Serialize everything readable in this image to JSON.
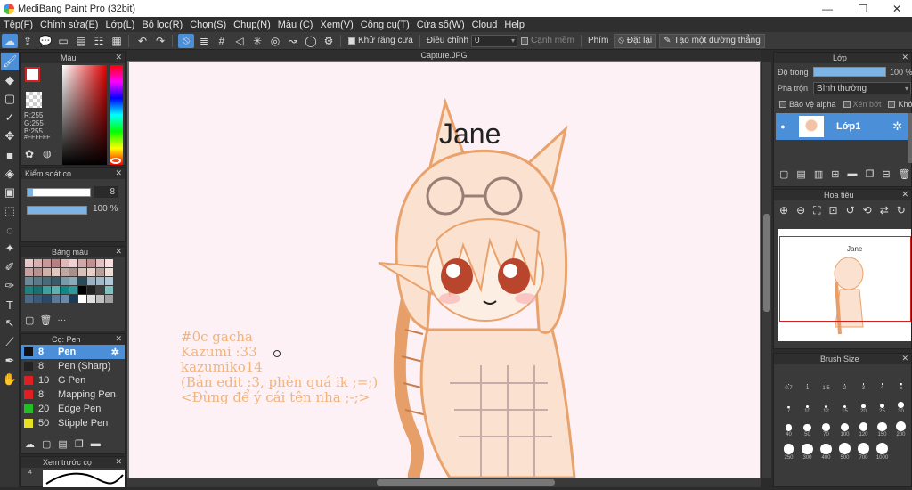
{
  "window": {
    "title": "MediBang Paint Pro (32bit)",
    "controls": [
      "—",
      "❐",
      "✕"
    ]
  },
  "menu": [
    "Tệp(F)",
    "Chỉnh sửa(E)",
    "Lớp(L)",
    "Bộ lọc(R)",
    "Chọn(S)",
    "Chụp(N)",
    "Màu (C)",
    "Xem(V)",
    "Công cụ(T)",
    "Cửa số(W)",
    "Cloud",
    "Help"
  ],
  "toolbar": {
    "antialias_label": "Khử răng cưa",
    "adjust_label": "Điều chỉnh",
    "adjust_value": "0",
    "smooth_edge_label": "Cạnh mềm",
    "shortcut_label": "Phím",
    "reset_label": "Đặt lại",
    "straight_line_label": "Tạo một đường thẳng"
  },
  "color_panel": {
    "title": "Màu",
    "r": "R:255",
    "g": "G:255",
    "b": "B:255",
    "hex": "#FFFFFF",
    "foreground": "#d42020",
    "background": "#ffffff"
  },
  "brush_control": {
    "title": "Kiểm soát cọ",
    "size_value": "8",
    "opacity_value": "100 %"
  },
  "swatch_panel": {
    "title": "Bảng màu",
    "colors": [
      "#e8c8c8",
      "#d8b0b0",
      "#c89898",
      "#b88080",
      "#e0b8b8",
      "#f0d0d0",
      "#d0a8a8",
      "#c09090",
      "#e0c0c0",
      "#f8e0e0",
      "#c8a0a0",
      "#b89090",
      "#d0b0a8",
      "#e0c8c0",
      "#c0a8a0",
      "#a89088",
      "#d8c0b8",
      "#e8d0c8",
      "#b8a098",
      "#f0e0d8",
      "#6a8a9a",
      "#5a7a8a",
      "#4a6a7a",
      "#3a5a6a",
      "#7a9aaa",
      "#8aaaba",
      "#2a4a5a",
      "#9ab0c0",
      "#a0b8c8",
      "#b0c8d8",
      "#208080",
      "#1a7070",
      "#40a0a0",
      "#60b0b0",
      "#108888",
      "#309898",
      "#000000",
      "#202020",
      "#404040",
      "#80c0c0",
      "#4a6a8a",
      "#3a5a7a",
      "#2a4a6a",
      "#5a7a9a",
      "#6a8aaa",
      "#1a3a5a",
      "#ffffff",
      "#e0e0e0",
      "#c0c0c0",
      "#a0a0a0"
    ],
    "more": "···"
  },
  "brush_panel": {
    "title": "Cọ: Pen",
    "items": [
      {
        "size": "8",
        "name": "Pen",
        "color": "#111111",
        "selected": true
      },
      {
        "size": "8",
        "name": "Pen (Sharp)",
        "color": "#222222",
        "selected": false
      },
      {
        "size": "10",
        "name": "G Pen",
        "color": "#e02020",
        "selected": false
      },
      {
        "size": "8",
        "name": "Mapping Pen",
        "color": "#e02020",
        "selected": false
      },
      {
        "size": "20",
        "name": "Edge Pen",
        "color": "#20c020",
        "selected": false
      },
      {
        "size": "50",
        "name": "Stipple Pen",
        "color": "#e8e020",
        "selected": false
      }
    ]
  },
  "preview_panel": {
    "title": "Xem trước cọ",
    "size_hint": "4"
  },
  "document": {
    "tab": "Capture.JPG"
  },
  "artwork": {
    "name_tag": "Jane",
    "lines": [
      "#0c gacha",
      "Kazumi :33",
      "kazumiko14",
      "(Bản edit :3, phèn quá ik ;=;)",
      "<Đừng để ý cái tên nha ;-;>"
    ]
  },
  "layer_panel": {
    "title": "Lớp",
    "opacity_label": "Độ trong",
    "opacity_value": "100 %",
    "blend_label": "Pha trộn",
    "blend_value": "Bình thường",
    "protect_alpha": "Bảo vệ alpha",
    "clipping": "Xén bớt",
    "lock": "Khóa",
    "layer_name": "Lớp1"
  },
  "navigator": {
    "title": "Hoa tiêu",
    "thumb_tag": "Jane"
  },
  "brush_size": {
    "title": "Brush Size",
    "sizes": [
      "0.7",
      "1",
      "1.5",
      "2",
      "3",
      "4",
      "5",
      "7",
      "10",
      "12",
      "15",
      "20",
      "25",
      "30",
      "40",
      "50",
      "70",
      "100",
      "120",
      "150",
      "200",
      "250",
      "300",
      "400",
      "500",
      "700",
      "1000"
    ],
    "dots": [
      1,
      1,
      1,
      1,
      1.5,
      1.5,
      2,
      2,
      2.5,
      3,
      3,
      4,
      5,
      6,
      7,
      7.5,
      8,
      8.5,
      9,
      9.5,
      10,
      10.5,
      11,
      11,
      11.5,
      12,
      12
    ]
  }
}
